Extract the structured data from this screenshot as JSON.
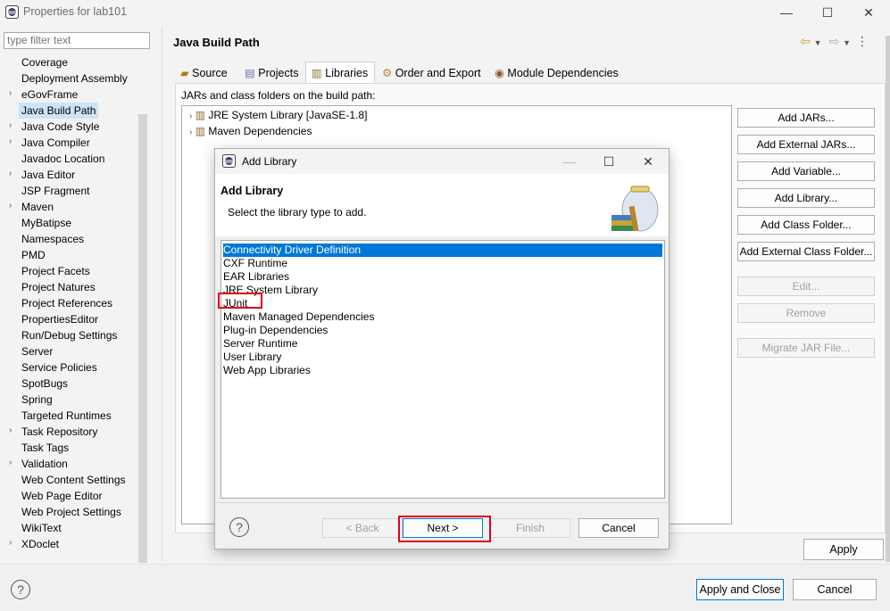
{
  "window": {
    "title": "Properties for lab101",
    "minimize": "—",
    "maximize": "☐",
    "close": "✕"
  },
  "filter": {
    "placeholder": "type filter text"
  },
  "tree": {
    "items": [
      {
        "label": "Coverage",
        "twisty": false
      },
      {
        "label": "Deployment Assembly",
        "twisty": false
      },
      {
        "label": "eGovFrame",
        "twisty": true
      },
      {
        "label": "Java Build Path",
        "twisty": false,
        "selected": true
      },
      {
        "label": "Java Code Style",
        "twisty": true
      },
      {
        "label": "Java Compiler",
        "twisty": true
      },
      {
        "label": "Javadoc Location",
        "twisty": false
      },
      {
        "label": "Java Editor",
        "twisty": true
      },
      {
        "label": "JSP Fragment",
        "twisty": false
      },
      {
        "label": "Maven",
        "twisty": true
      },
      {
        "label": "MyBatipse",
        "twisty": false
      },
      {
        "label": "Namespaces",
        "twisty": false
      },
      {
        "label": "PMD",
        "twisty": false
      },
      {
        "label": "Project Facets",
        "twisty": false
      },
      {
        "label": "Project Natures",
        "twisty": false
      },
      {
        "label": "Project References",
        "twisty": false
      },
      {
        "label": "PropertiesEditor",
        "twisty": false
      },
      {
        "label": "Run/Debug Settings",
        "twisty": false
      },
      {
        "label": "Server",
        "twisty": false
      },
      {
        "label": "Service Policies",
        "twisty": false
      },
      {
        "label": "SpotBugs",
        "twisty": false
      },
      {
        "label": "Spring",
        "twisty": false
      },
      {
        "label": "Targeted Runtimes",
        "twisty": false
      },
      {
        "label": "Task Repository",
        "twisty": true
      },
      {
        "label": "Task Tags",
        "twisty": false
      },
      {
        "label": "Validation",
        "twisty": true
      },
      {
        "label": "Web Content Settings",
        "twisty": false
      },
      {
        "label": "Web Page Editor",
        "twisty": false
      },
      {
        "label": "Web Project Settings",
        "twisty": false
      },
      {
        "label": "WikiText",
        "twisty": false
      },
      {
        "label": "XDoclet",
        "twisty": true
      }
    ]
  },
  "page": {
    "title": "Java Build Path",
    "tabs": [
      "Source",
      "Projects",
      "Libraries",
      "Order and Export",
      "Module Dependencies"
    ],
    "active_tab": "Libraries",
    "jars_label": "JARs and class folders on the build path:",
    "build_items": [
      "JRE System Library [JavaSE-1.8]",
      "Maven Dependencies"
    ],
    "buttons": {
      "add_jars": "Add JARs...",
      "add_external_jars": "Add External JARs...",
      "add_variable": "Add Variable...",
      "add_library": "Add Library...",
      "add_class_folder": "Add Class Folder...",
      "add_external_class_folder": "Add External Class Folder...",
      "edit": "Edit...",
      "remove": "Remove",
      "migrate_jar": "Migrate JAR File..."
    },
    "apply": "Apply"
  },
  "footer": {
    "help": "?",
    "apply_and_close": "Apply and Close",
    "cancel": "Cancel"
  },
  "dialog": {
    "title": "Add Library",
    "heading": "Add Library",
    "description": "Select the library type to add.",
    "libraries": [
      "Connectivity Driver Definition",
      "CXF Runtime",
      "EAR Libraries",
      "JRE System Library",
      "JUnit",
      "Maven Managed Dependencies",
      "Plug-in Dependencies",
      "Server Runtime",
      "User Library",
      "Web App Libraries"
    ],
    "selected_library": "Connectivity Driver Definition",
    "highlighted_library": "JUnit",
    "help": "?",
    "back": "< Back",
    "next": "Next >",
    "finish": "Finish",
    "cancel": "Cancel"
  },
  "colors": {
    "selection": "#0078d7",
    "tree_selection": "#cce4f7",
    "highlight_box": "#e0001a"
  }
}
